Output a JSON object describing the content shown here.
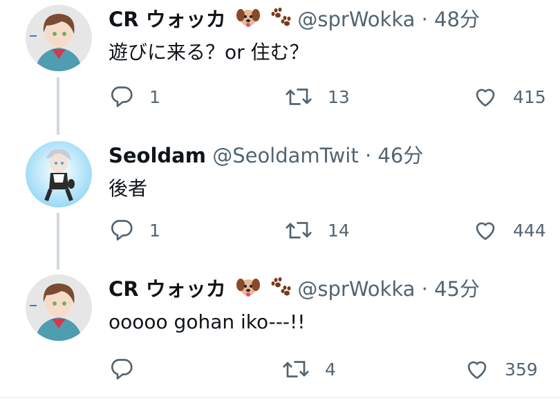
{
  "tweets": [
    {
      "author_name": "CR ウォッカ",
      "author_emoji": [
        "dog-face-emoji",
        "paw-prints-emoji"
      ],
      "handle": "@sprWokka",
      "separator": "·",
      "time": "48分",
      "text": "遊びに来る？or 住む？",
      "replies": "1",
      "retweets": "13",
      "likes": "415"
    },
    {
      "author_name": "Seoldam",
      "handle": "@SeoldamTwit",
      "separator": "·",
      "time": "46分",
      "text": "後者",
      "replies": "1",
      "retweets": "14",
      "likes": "444"
    },
    {
      "author_name": "CR ウォッカ",
      "author_emoji": [
        "dog-face-emoji",
        "paw-prints-emoji"
      ],
      "handle": "@sprWokka",
      "separator": "·",
      "time": "45分",
      "text": "ooooo gohan iko---!!",
      "replies": "",
      "retweets": "4",
      "likes": "359"
    }
  ],
  "colors": {
    "text_primary": "#0f1419",
    "text_secondary": "#536471",
    "thread_line": "#cfd9de",
    "icon": "#536471"
  }
}
